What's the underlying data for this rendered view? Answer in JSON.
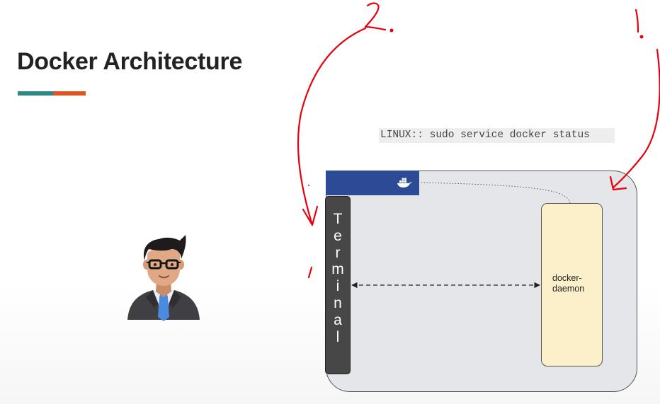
{
  "slide": {
    "title": "Docker Architecture",
    "accent_colors": [
      "#2a8a86",
      "#e5531c"
    ]
  },
  "command": {
    "text": "LINUX:: sudo service docker status"
  },
  "diagram": {
    "terminal_label": "Terminal",
    "daemon_label": "docker-\ndaemon",
    "host_bar_icon": "docker-whale-icon",
    "colors": {
      "host_fill": "#e4e6e9",
      "topbar": "#2d4a97",
      "terminal": "#474747",
      "daemon_fill": "#fbf0c9"
    }
  },
  "annotations": {
    "labels": [
      "2.",
      "1."
    ],
    "ink_color": "#e8000e"
  },
  "user": {
    "icon": "user-avatar-icon"
  }
}
